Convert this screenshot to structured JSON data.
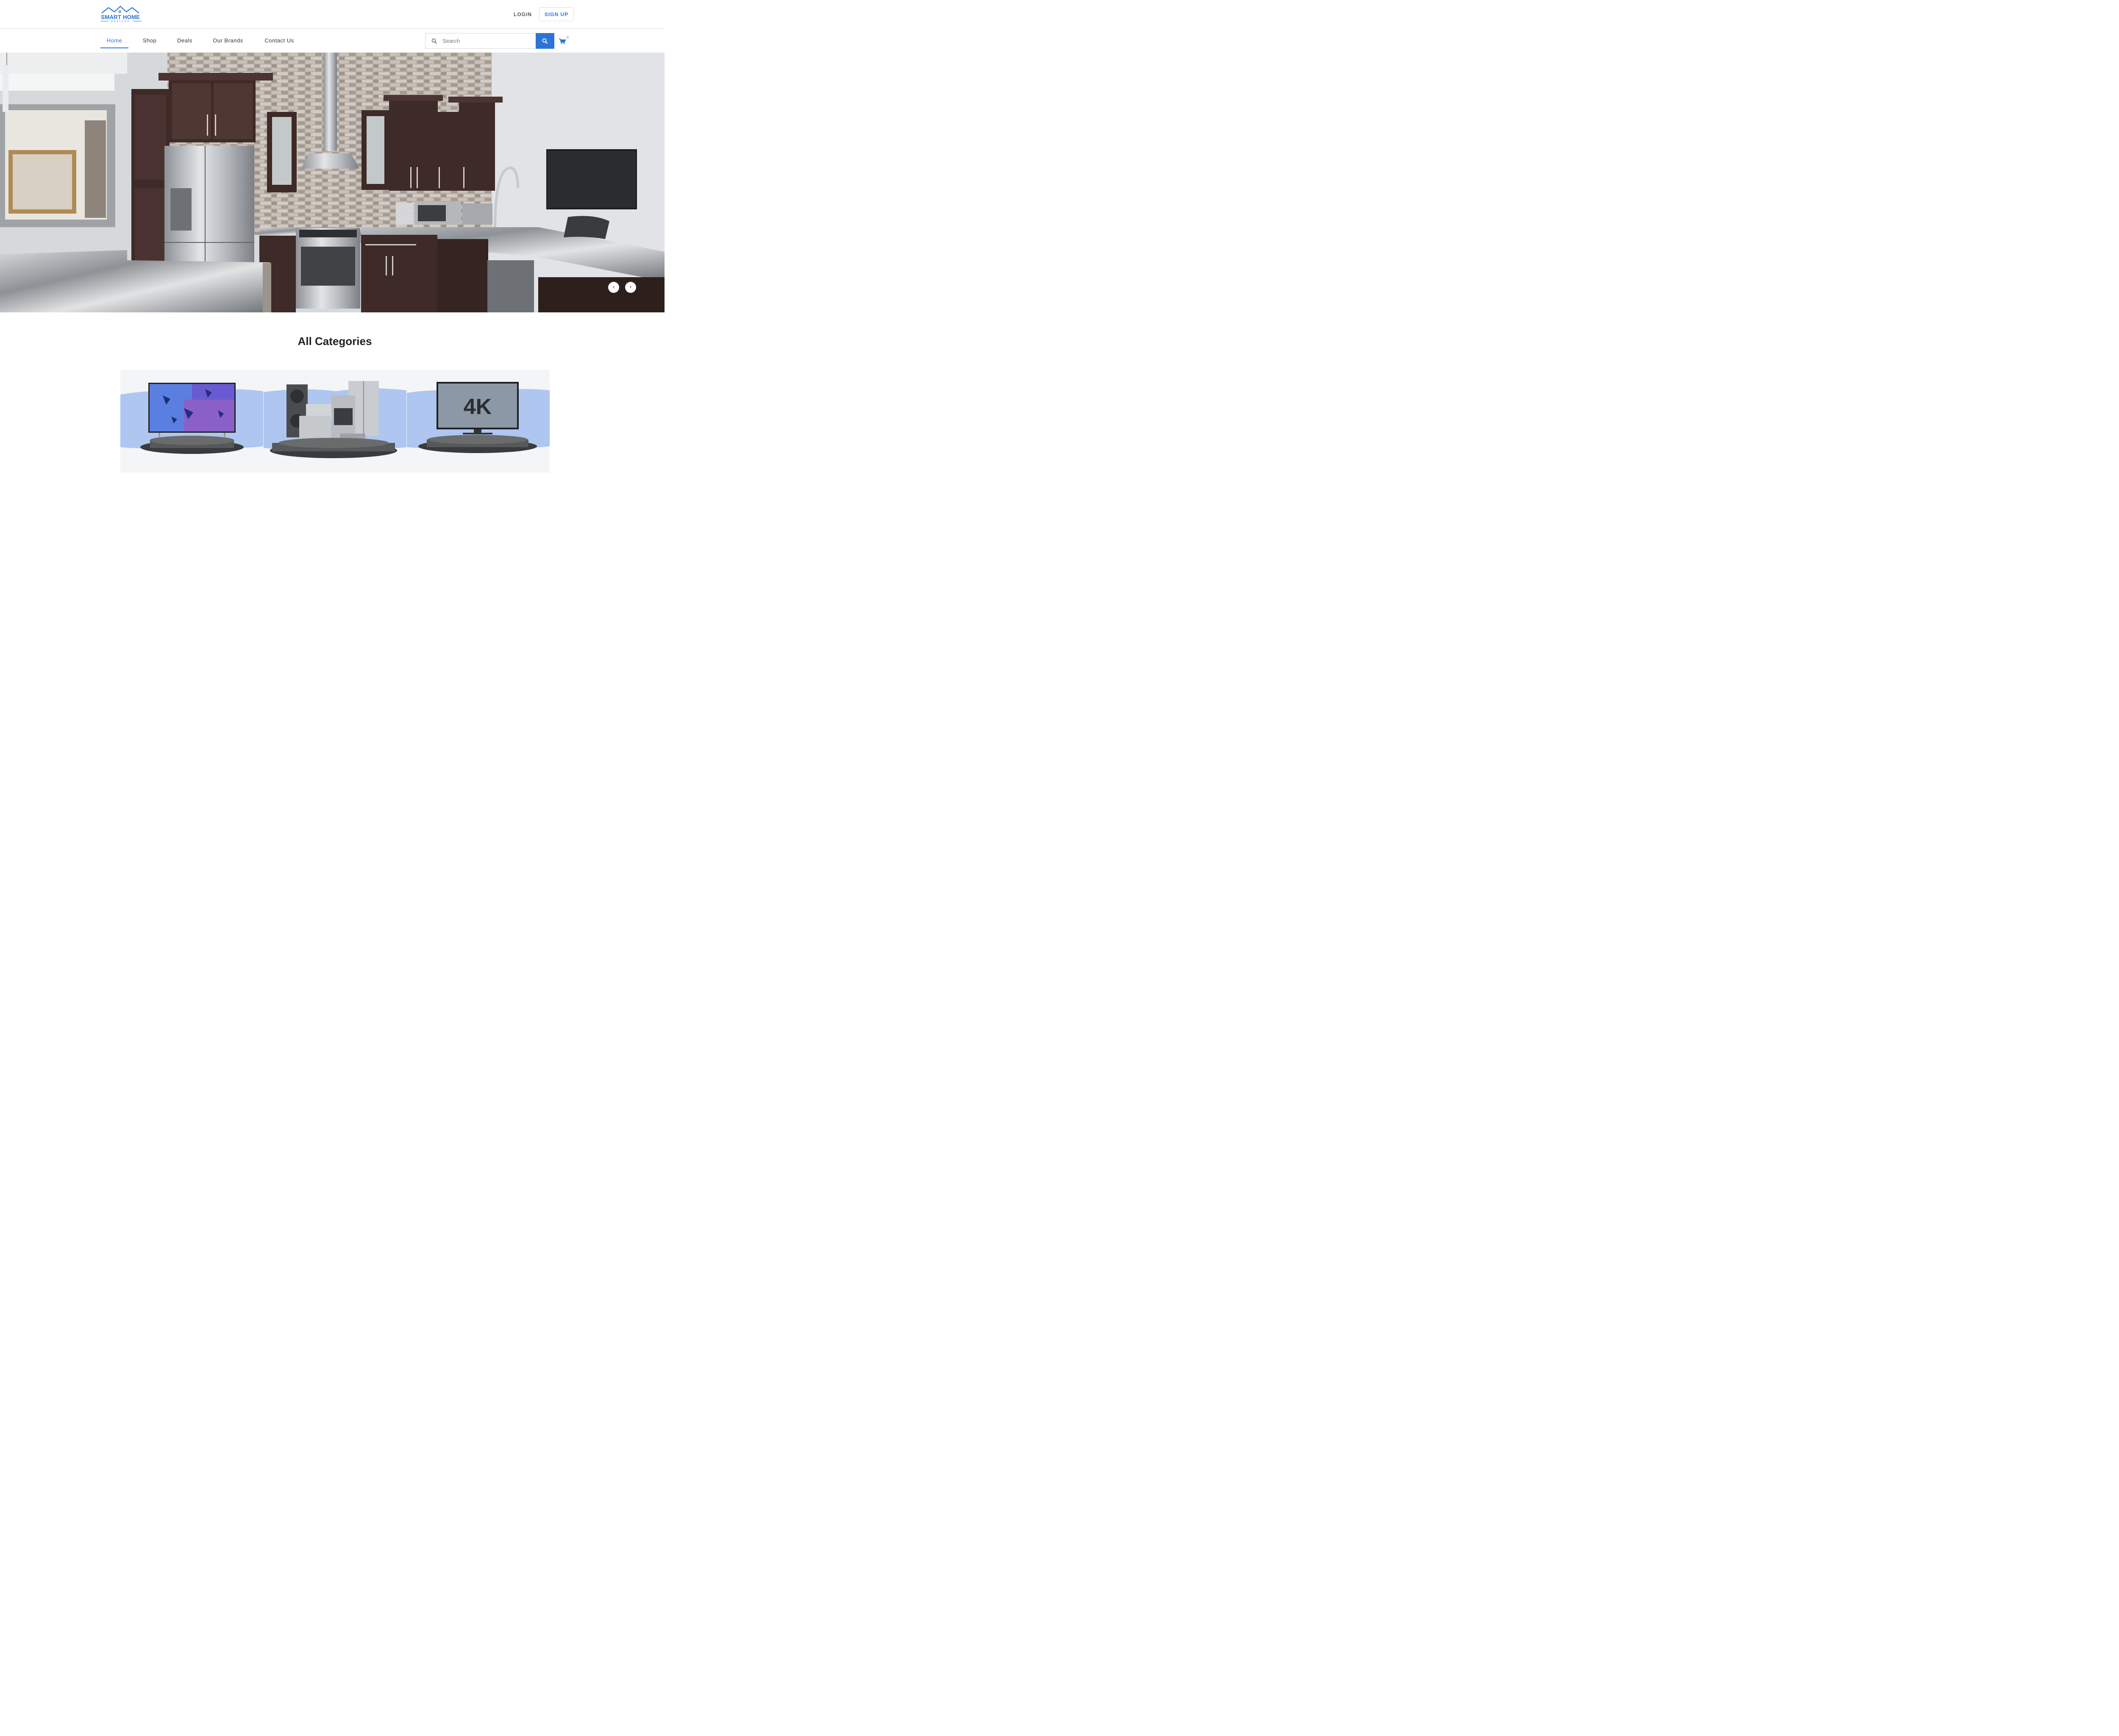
{
  "brand": {
    "line1": "SMART HOME",
    "line2": "DEVICES",
    "accent": "#2b74d6"
  },
  "header": {
    "login_label": "LOGIN",
    "signup_label": "SIGN UP"
  },
  "nav": {
    "items": [
      {
        "label": "Home",
        "active": true
      },
      {
        "label": "Shop",
        "active": false
      },
      {
        "label": "Deals",
        "active": false
      },
      {
        "label": "Our Brands",
        "active": false
      },
      {
        "label": "Contact Us",
        "active": false
      }
    ]
  },
  "search": {
    "placeholder": "Search",
    "value": ""
  },
  "cart": {
    "count": "0",
    "icon": "cart-icon"
  },
  "hero": {
    "prev_icon": "‹",
    "next_icon": "›"
  },
  "categories": {
    "title": "All Categories",
    "cards": [
      {
        "name": "tv-category",
        "overlay_text": ""
      },
      {
        "name": "appliances-category",
        "overlay_text": ""
      },
      {
        "name": "4k-tv-category",
        "overlay_text": "4K"
      }
    ]
  }
}
